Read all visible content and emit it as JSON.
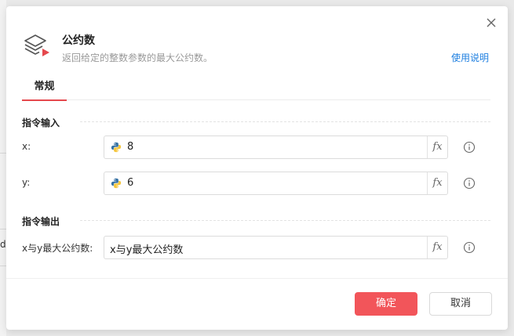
{
  "background": {
    "edge_text": "d"
  },
  "dialog": {
    "title": "公约数",
    "subtitle": "返回给定的整数参数的最大公约数。",
    "help_link": "使用说明",
    "close_icon": "close-icon",
    "header_icon": "layers-play-icon"
  },
  "tabs": [
    {
      "label": "常规",
      "active": true
    }
  ],
  "sections": {
    "input": {
      "title": "指令输入"
    },
    "output": {
      "title": "指令输出"
    }
  },
  "fields": {
    "x": {
      "label": "x:",
      "value": "8",
      "icon": "python-icon",
      "fx": "fx"
    },
    "y": {
      "label": "y:",
      "value": "6",
      "icon": "python-icon",
      "fx": "fx"
    },
    "result": {
      "label": "x与y最大公约数:",
      "value": "x与y最大公约数",
      "fx": "fx"
    }
  },
  "buttons": {
    "confirm": "确定",
    "cancel": "取消"
  },
  "colors": {
    "accent": "#e5484d",
    "confirm_bg": "#f2555a",
    "link": "#1e7fe0"
  }
}
